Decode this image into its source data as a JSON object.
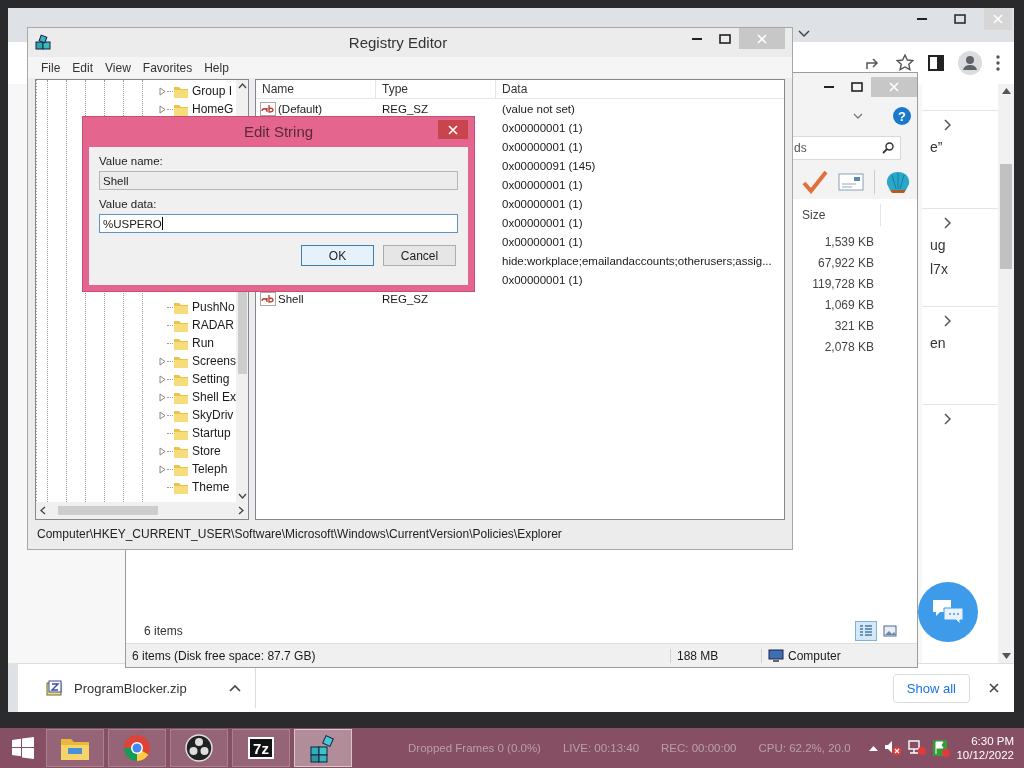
{
  "chrome": {
    "page_cards": [
      {
        "fragments": [
          "e”"
        ]
      },
      {
        "fragments": [
          "ug",
          "l7x"
        ]
      },
      {
        "fragments": [
          "en"
        ]
      }
    ],
    "download": {
      "file_name": "ProgramBlocker.zip",
      "show_all": "Show all"
    }
  },
  "explorer": {
    "help": "?",
    "search_value": "ds",
    "size_header": "Size",
    "sizes": [
      "1,539 KB",
      "67,922 KB",
      "119,728 KB",
      "1,069 KB",
      "321 KB",
      "2,078 KB"
    ],
    "item_count": "6 items",
    "view_buttons": [
      {
        "selected": true
      },
      {
        "selected": false
      }
    ],
    "status_bar": {
      "items": "6 items (Disk free space: 87.7 GB)",
      "size": "188 MB",
      "location": "Computer"
    }
  },
  "regedit": {
    "title": "Registry Editor",
    "menu": [
      "File",
      "Edit",
      "View",
      "Favorites",
      "Help"
    ],
    "tree": [
      {
        "label": "Group I",
        "expandable": true
      },
      {
        "label": "HomeG",
        "expandable": true
      },
      {
        "label": "PushNo",
        "expandable": false
      },
      {
        "label": "RADAR",
        "expandable": false
      },
      {
        "label": "Run",
        "expandable": false
      },
      {
        "label": "Screens",
        "expandable": true
      },
      {
        "label": "Setting",
        "expandable": true
      },
      {
        "label": "Shell Ex",
        "expandable": true
      },
      {
        "label": "SkyDriv",
        "expandable": true
      },
      {
        "label": "Startup",
        "expandable": false
      },
      {
        "label": "Store",
        "expandable": true
      },
      {
        "label": "Teleph",
        "expandable": true
      },
      {
        "label": "Theme",
        "expandable": false
      }
    ],
    "columns": [
      "Name",
      "Type",
      "Data"
    ],
    "rows": [
      {
        "name": "(Default)",
        "type": "REG_SZ",
        "data": "(value not set)"
      },
      {
        "data": "0x00000001 (1)"
      },
      {
        "data": "0x00000001 (1)"
      },
      {
        "data": "0x00000091 (145)"
      },
      {
        "data": "0x00000001 (1)"
      },
      {
        "data": "0x00000001 (1)"
      },
      {
        "data": "0x00000001 (1)"
      },
      {
        "data": "0x00000001 (1)"
      },
      {
        "data": "hide:workplace;emailandaccounts;otherusers;assig..."
      },
      {
        "data": "0x00000001 (1)"
      },
      {
        "name": "Shell",
        "type": "REG_SZ"
      }
    ],
    "status_path": "Computer\\HKEY_CURRENT_USER\\Software\\Microsoft\\Windows\\CurrentVersion\\Policies\\Explorer"
  },
  "dialog": {
    "title": "Edit String",
    "name_label": "Value name:",
    "name_value": "Shell",
    "data_label": "Value data:",
    "data_value": "%USPERO",
    "buttons": [
      "OK",
      "Cancel"
    ]
  },
  "taskbar": {
    "apps": [
      {
        "kind": "folder",
        "selected": false
      },
      {
        "kind": "browser",
        "selected": false
      },
      {
        "kind": "recorder",
        "selected": false
      },
      {
        "kind": "archiver",
        "label": "7z",
        "selected": false
      },
      {
        "kind": "registry",
        "selected": true
      }
    ],
    "obs_stats": [
      "Dropped Frames 0 (0.0%)",
      "LIVE: 00:13:40",
      "REC: 00:00:00",
      "CPU: 62.2%, 20.0"
    ],
    "clock": {
      "time": "6:30 PM",
      "date": "10/12/2022"
    }
  }
}
